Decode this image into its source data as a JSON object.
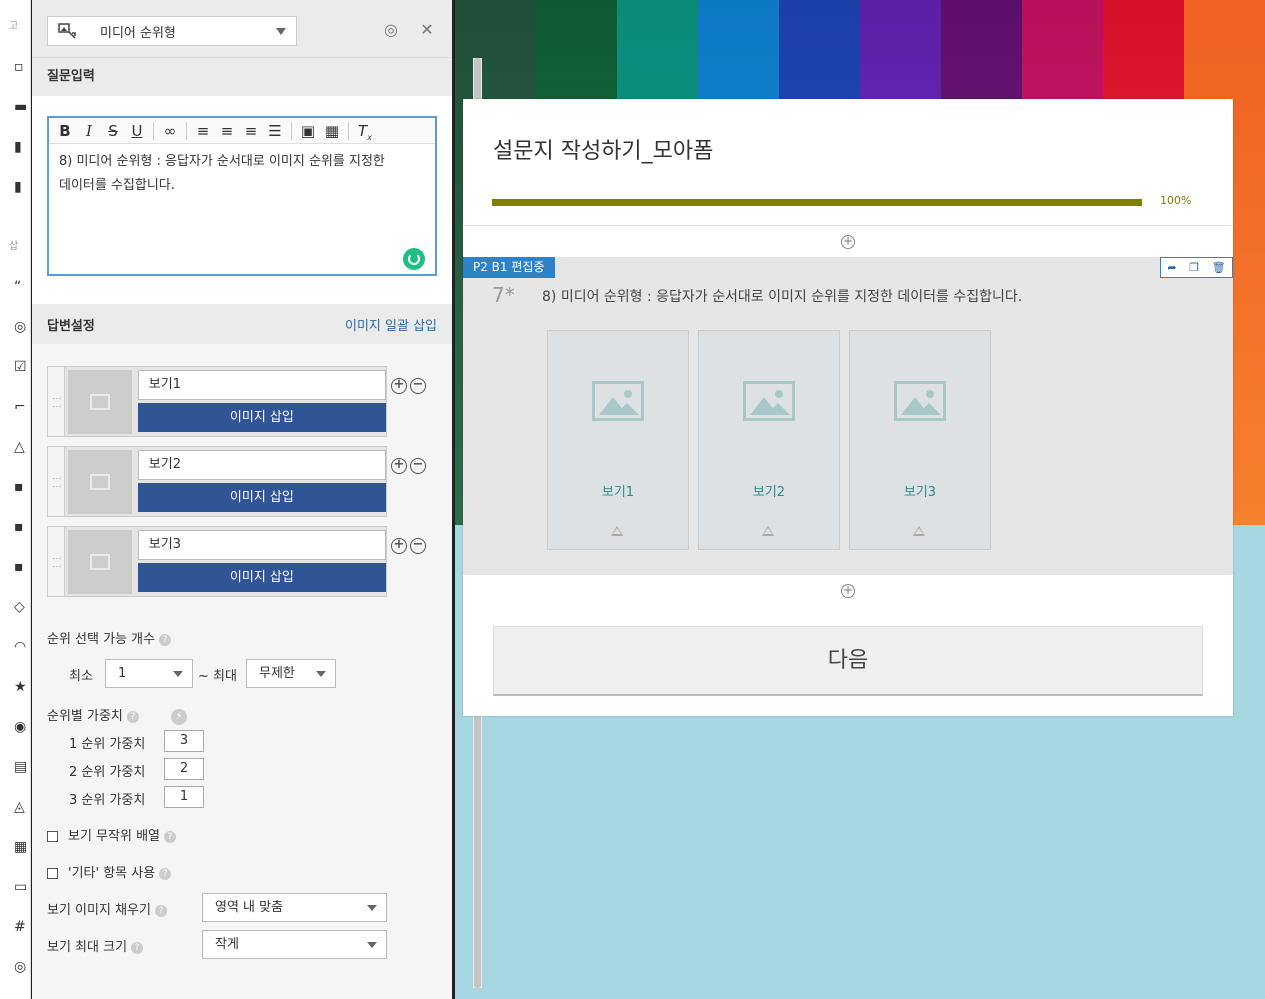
{
  "editor": {
    "type_label": "미디어 순위형",
    "question_section": "질문입력",
    "question_text_line1": "8) 미디어 순위형 : 응답자가 순서대로 이미지 순위를 지정한",
    "question_text_line2": "데이터를 수집합니다.",
    "answer_section": "답변설정",
    "bulk_insert_link": "이미지 일괄 삽입",
    "choices": [
      {
        "name": "보기1",
        "insert_label": "이미지 삽입"
      },
      {
        "name": "보기2",
        "insert_label": "이미지 삽입"
      },
      {
        "name": "보기3",
        "insert_label": "이미지 삽입"
      }
    ],
    "rank_count_label": "순위 선택 가능 개수",
    "min_label": "최소",
    "min_value": "1",
    "max_label": "~ 최대",
    "max_value": "무제한",
    "weight_label": "순위별 가중치",
    "weights": [
      {
        "label": "1 순위 가중치",
        "value": "3"
      },
      {
        "label": "2 순위 가중치",
        "value": "2"
      },
      {
        "label": "3 순위 가중치",
        "value": "1"
      }
    ],
    "random_label": "보기 무작위 배열",
    "other_label": "'기타' 항목 사용",
    "fill_label": "보기 이미지 채우기",
    "fill_value": "영역 내 맞춤",
    "maxsize_label": "보기 최대 크기",
    "maxsize_value": "작게"
  },
  "survey": {
    "title": "설문지 작성하기_모아폼",
    "progress_percent": 100,
    "progress_label": "100%",
    "edit_tag": "P2 B1 편집중",
    "question_number": "7*",
    "question_text": "8) 미디어 순위형 : 응답자가 순서대로 이미지 순위를 지정한 데이터를 수집합니다.",
    "cards": [
      {
        "label": "보기1"
      },
      {
        "label": "보기2"
      },
      {
        "label": "보기3"
      }
    ],
    "next_label": "다음"
  },
  "colors": {
    "accent_blue": "#2f5597",
    "progress": "#7f7f00",
    "tag_blue": "#2e82c8"
  }
}
